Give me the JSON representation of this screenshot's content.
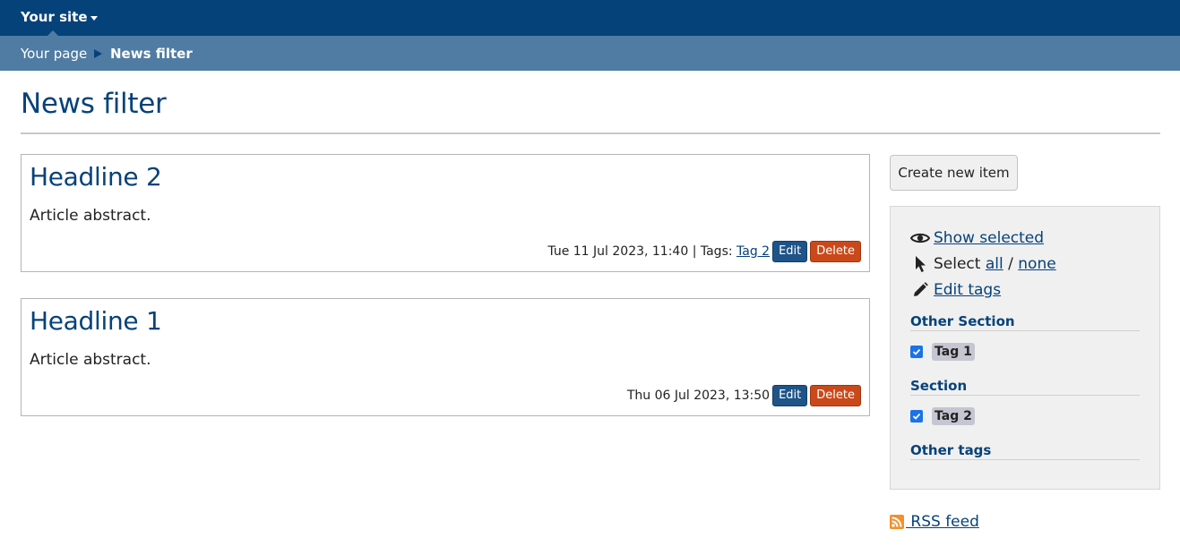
{
  "header": {
    "site_label": "Your site"
  },
  "breadcrumb": {
    "parent": "Your page",
    "current": "News filter"
  },
  "page": {
    "title": "News filter"
  },
  "articles": [
    {
      "headline": "Headline 2",
      "abstract": "Article abstract.",
      "date": "Tue 11 Jul 2023, 11:40",
      "tags_prefix": " | Tags: ",
      "tag": "Tag 2",
      "edit_label": "Edit",
      "delete_label": "Delete"
    },
    {
      "headline": "Headline 1",
      "abstract": "Article abstract.",
      "date": "Thu 06 Jul 2023, 13:50",
      "edit_label": "Edit",
      "delete_label": "Delete"
    }
  ],
  "sidebar": {
    "create_label": "Create new item",
    "show_selected": "Show selected",
    "select_prefix": "Select ",
    "select_all": "all",
    "select_sep": " / ",
    "select_none": "none",
    "edit_tags": "Edit tags",
    "sections": [
      {
        "title": "Other Section",
        "tags": [
          {
            "label": "Tag 1",
            "checked": true
          }
        ]
      },
      {
        "title": "Section",
        "tags": [
          {
            "label": "Tag 2",
            "checked": true
          }
        ]
      },
      {
        "title": "Other tags",
        "tags": []
      }
    ],
    "rss_label": " RSS feed"
  },
  "colors": {
    "topbar": "#06427a",
    "crumbbar": "#507ca3",
    "edit_button": "#1f5488",
    "delete_button": "#c9491a",
    "rss": "#f0912d"
  },
  "icons": {
    "show_selected": "eye-icon",
    "select": "pointer-icon",
    "edit_tags": "pencil-icon",
    "rss": "rss-icon"
  }
}
